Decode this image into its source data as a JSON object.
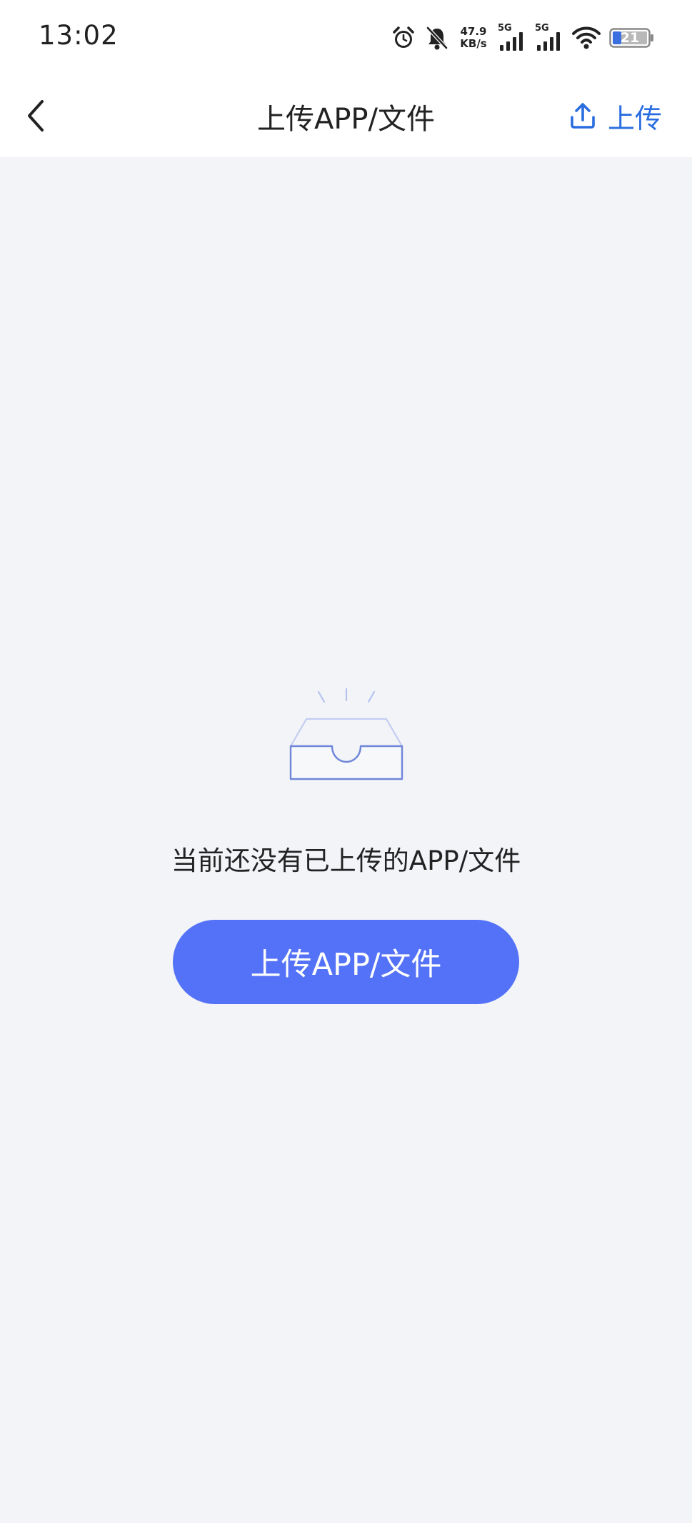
{
  "status_bar": {
    "time": "13:02",
    "net_speed_value": "47.9",
    "net_speed_unit": "KB/s",
    "signal_1_label": "5G",
    "signal_2_label": "5G",
    "battery_level": "21"
  },
  "header": {
    "title": "上传APP/文件",
    "upload_label": "上传"
  },
  "empty_state": {
    "message": "当前还没有已上传的APP/文件",
    "button_label": "上传APP/文件"
  },
  "colors": {
    "accent": "#2a6de0",
    "primary_button": "#5472f7",
    "background": "#f2f4f8",
    "illustration": "#6f86d9"
  },
  "icons": {
    "back": "chevron-left-icon",
    "upload": "upload-icon",
    "alarm": "alarm-icon",
    "mute": "bell-off-icon",
    "wifi": "wifi-icon",
    "battery": "battery-icon",
    "empty": "empty-tray-icon"
  }
}
